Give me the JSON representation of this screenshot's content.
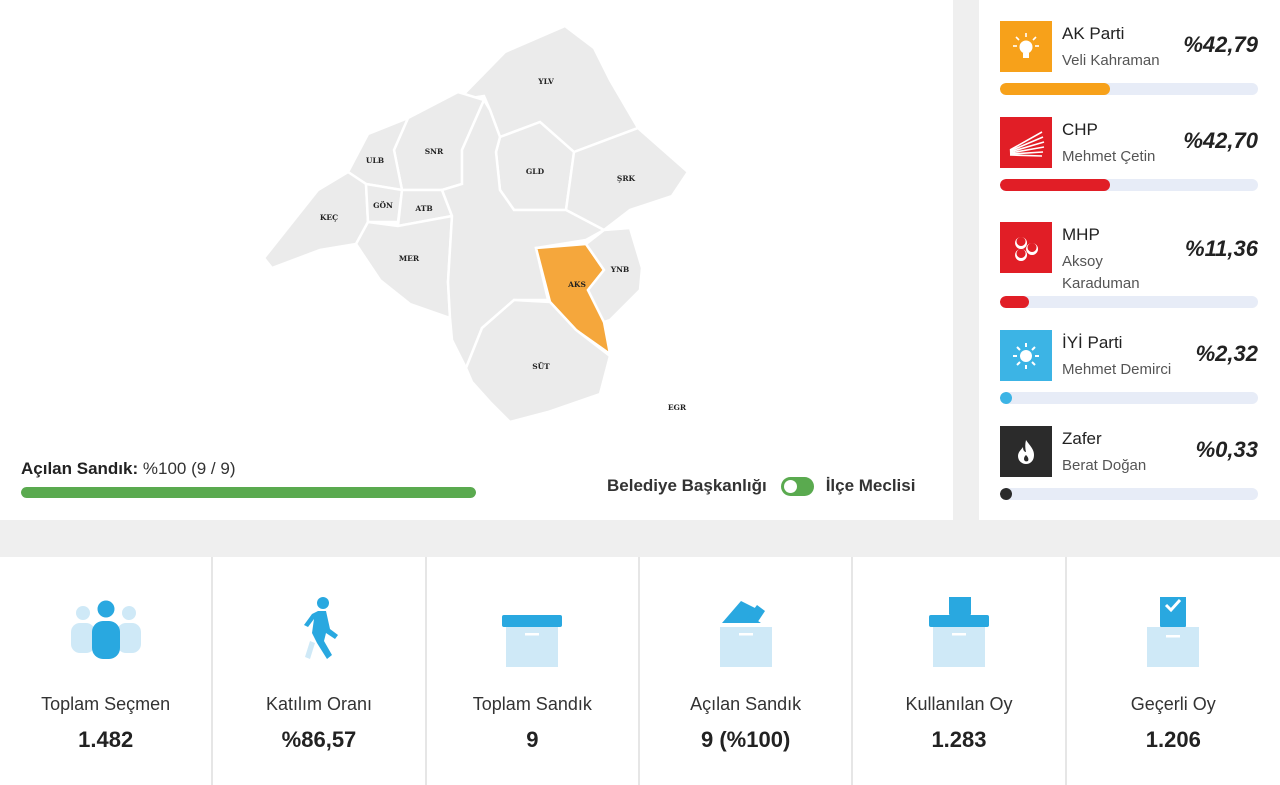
{
  "map": {
    "districts": [
      {
        "code": "YLV",
        "active": false
      },
      {
        "code": "SNR",
        "active": false
      },
      {
        "code": "ULB",
        "active": false
      },
      {
        "code": "GLD",
        "active": false
      },
      {
        "code": "ŞRK",
        "active": false
      },
      {
        "code": "KEÇ",
        "active": false
      },
      {
        "code": "GÖN",
        "active": false
      },
      {
        "code": "ATB",
        "active": false
      },
      {
        "code": "MER",
        "active": false
      },
      {
        "code": "AKS",
        "active": true
      },
      {
        "code": "YNB",
        "active": false
      },
      {
        "code": "SÜT",
        "active": false
      },
      {
        "code": "EGR",
        "active": false
      }
    ],
    "highlight_color": "#f5a73c",
    "default_color": "#ebebeb"
  },
  "ballot_progress": {
    "label": "Açılan Sandık:",
    "value": "%100 (9 / 9)",
    "percent": 100,
    "color": "#5aaa4f"
  },
  "toggle": {
    "left_label": "Belediye Başkanlığı",
    "right_label": "İlçe Meclisi"
  },
  "parties": [
    {
      "name": "AK Parti",
      "candidate": "Veli Kahraman",
      "percent_label": "%42,79",
      "percent": 42.79,
      "color": "#f7a11a",
      "icon": "ak-parti-bulb-icon"
    },
    {
      "name": "CHP",
      "candidate": "Mehmet Çetin",
      "percent_label": "%42,70",
      "percent": 42.7,
      "color": "#e11e26",
      "icon": "chp-six-arrows-icon"
    },
    {
      "name": "MHP",
      "candidate": "Aksoy Karaduman",
      "percent_label": "%11,36",
      "percent": 11.36,
      "color": "#e11e26",
      "icon": "mhp-three-crescents-icon"
    },
    {
      "name": "İYİ Parti",
      "candidate": "Mehmet Demirci",
      "percent_label": "%2,32",
      "percent": 2.32,
      "color": "#3cb4e5",
      "icon": "iyi-parti-sun-icon"
    },
    {
      "name": "Zafer",
      "candidate": "Berat Doğan",
      "percent_label": "%0,33",
      "percent": 0.33,
      "color": "#2b2b2b",
      "icon": "zafer-flame-icon"
    }
  ],
  "stats": [
    {
      "label": "Toplam Seçmen",
      "value": "1.482",
      "icon": "voters-group-icon"
    },
    {
      "label": "Katılım Oranı",
      "value": "%86,57",
      "icon": "walking-person-icon"
    },
    {
      "label": "Toplam Sandık",
      "value": "9",
      "icon": "ballot-box-icon"
    },
    {
      "label": "Açılan Sandık",
      "value": "9 (%100)",
      "icon": "opened-ballot-box-icon"
    },
    {
      "label": "Kullanılan Oy",
      "value": "1.283",
      "icon": "cast-vote-box-icon"
    },
    {
      "label": "Geçerli Oy",
      "value": "1.206",
      "icon": "valid-vote-check-icon"
    }
  ],
  "colors": {
    "accent_blue": "#29a8e0",
    "light_blue": "#cfe9f7",
    "bar_track": "#e7ecf7"
  }
}
